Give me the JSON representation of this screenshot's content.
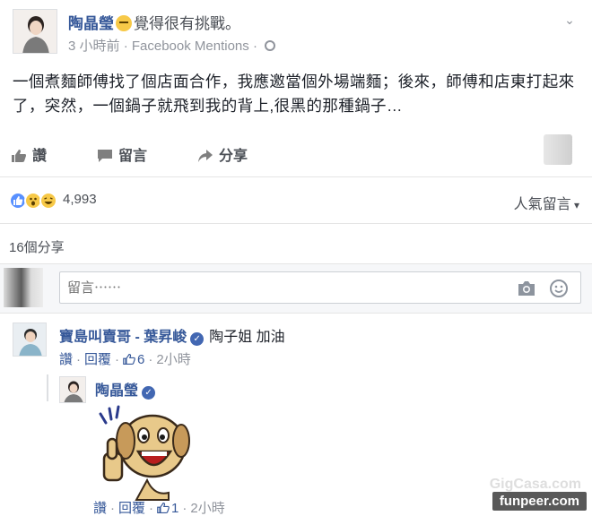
{
  "post": {
    "author": "陶晶瑩",
    "feeling": "覺得很有挑戰。",
    "time": "3 小時前",
    "source": "Facebook Mentions",
    "body": "一個煮麵師傅找了個店面合作，我應邀當個外場端麵；後來，師傅和店東打起來了，突然，一個鍋子就飛到我的背上,很黑的那種鍋子…"
  },
  "actions": {
    "like": "讚",
    "comment": "留言",
    "share": "分享"
  },
  "reactions": {
    "count": "4,993",
    "sort_label": "人氣留言"
  },
  "shares": "16個分享",
  "comment_box": {
    "placeholder": "留言⋯⋯"
  },
  "comments": [
    {
      "name": "寶島叫賣哥 - 葉昇峻",
      "text": "陶子姐 加油",
      "like": "讚",
      "reply": "回覆",
      "likes": "6",
      "time": "2小時"
    }
  ],
  "reply": {
    "name": "陶晶瑩",
    "like": "讚",
    "reply": "回覆",
    "likes": "1",
    "time": "2小時"
  },
  "watermark": {
    "main": "funpeer.com",
    "ghost": "GigCasa.com"
  },
  "colors": {
    "link": "#365899",
    "muted": "#90949c",
    "like_blue": "#5890ff"
  }
}
